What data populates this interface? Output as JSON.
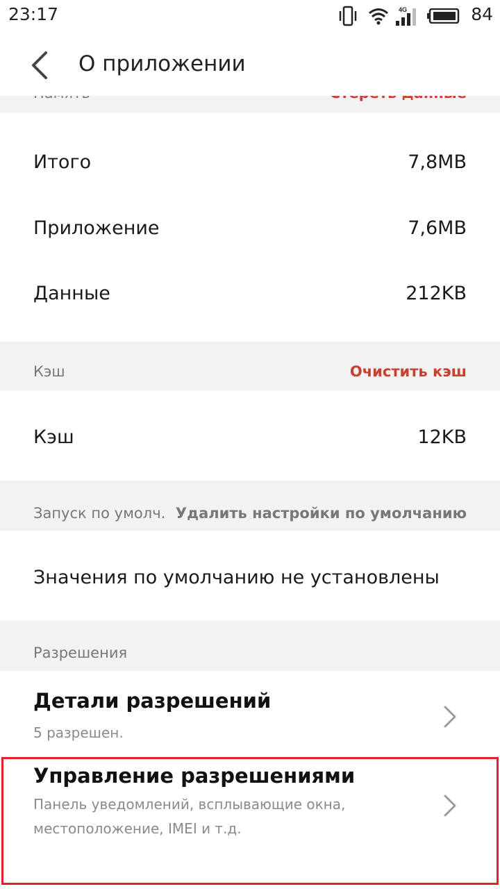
{
  "status_bar": {
    "time": "23:17",
    "network_type": "4G",
    "battery_level": "84"
  },
  "header": {
    "title": "О приложении"
  },
  "memory": {
    "title": "Память",
    "action": "Стереть данные",
    "rows": [
      {
        "label": "Итого",
        "value": "7,8MB"
      },
      {
        "label": "Приложение",
        "value": "7,6MB"
      },
      {
        "label": "Данные",
        "value": "212KB"
      }
    ]
  },
  "cache": {
    "title": "Кэш",
    "action": "Очистить кэш",
    "rows": [
      {
        "label": "Кэш",
        "value": "12KB"
      }
    ]
  },
  "defaults": {
    "title": "Запуск по умолч.",
    "action": "Удалить настройки по умолчанию",
    "text": "Значения по умолчанию не установлены"
  },
  "permissions": {
    "title": "Разрешения",
    "items": [
      {
        "title": "Детали разрешений",
        "subtitle": "5 разрешен."
      },
      {
        "title": "Управление разрешениями",
        "subtitle_line1": "Панель уведомлений, всплывающие окна,",
        "subtitle_line2": "местоположение, IMEI и т.д."
      }
    ]
  },
  "colors": {
    "accent": "#c8402e",
    "highlight": "#e0202e",
    "section_bg": "#f2f2f2"
  }
}
